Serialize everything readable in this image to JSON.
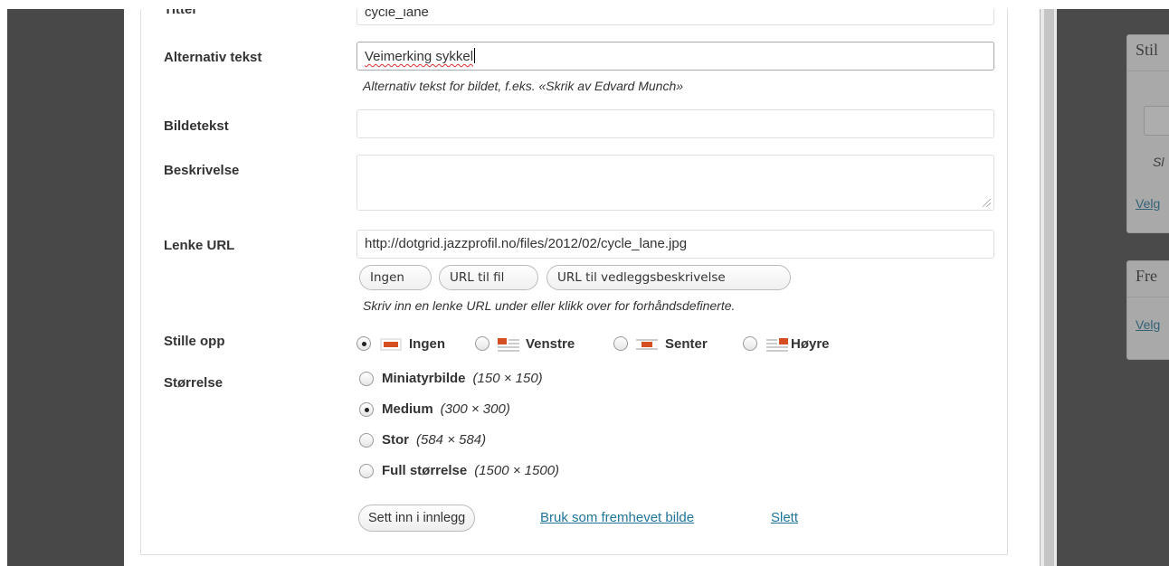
{
  "form": {
    "title_label": "Tittel",
    "title_value": "cycle_lane",
    "alt_label": "Alternativ tekst",
    "alt_value": "Veimerking sykkel",
    "alt_help": "Alternativ tekst for bildet, f.eks. «Skrik av Edvard Munch»",
    "caption_label": "Bildetekst",
    "caption_value": "",
    "description_label": "Beskrivelse",
    "description_value": "",
    "link_label": "Lenke URL",
    "link_value": "http://dotgrid.jazzprofil.no/files/2012/02/cycle_lane.jpg",
    "link_buttons": [
      "Ingen",
      "URL til fil",
      "URL til vedleggsbeskrivelse"
    ],
    "link_help": "Skriv inn en lenke URL under eller klikk over for forhåndsdefinerte.",
    "align_label": "Stille opp",
    "align_options": [
      {
        "label": "Ingen",
        "selected": true,
        "icon": "align-none-icon"
      },
      {
        "label": "Venstre",
        "selected": false,
        "icon": "align-left-icon"
      },
      {
        "label": "Senter",
        "selected": false,
        "icon": "align-center-icon"
      },
      {
        "label": "Høyre",
        "selected": false,
        "icon": "align-right-icon"
      }
    ],
    "size_label": "Størrelse",
    "size_options": [
      {
        "name": "Miniatyrbilde",
        "dim": "(150 × 150)",
        "selected": false
      },
      {
        "name": "Medium",
        "dim": "(300 × 300)",
        "selected": true
      },
      {
        "name": "Stor",
        "dim": "(584 × 584)",
        "selected": false
      },
      {
        "name": "Full størrelse",
        "dim": "(1500 × 1500)",
        "selected": false
      }
    ],
    "insert_button": "Sett inn i innlegg",
    "featured_link": "Bruk som fremhevet bilde",
    "delete_link": "Slett"
  },
  "sidebar": {
    "box1_heading": "Stil",
    "box1_italic": "Sl",
    "box1_link": "Velg",
    "box2_heading": "Fre",
    "box2_link": "Velg"
  },
  "colors": {
    "link": "#21759b",
    "overlay": "#484848",
    "accent_icon": "#d54e21"
  }
}
